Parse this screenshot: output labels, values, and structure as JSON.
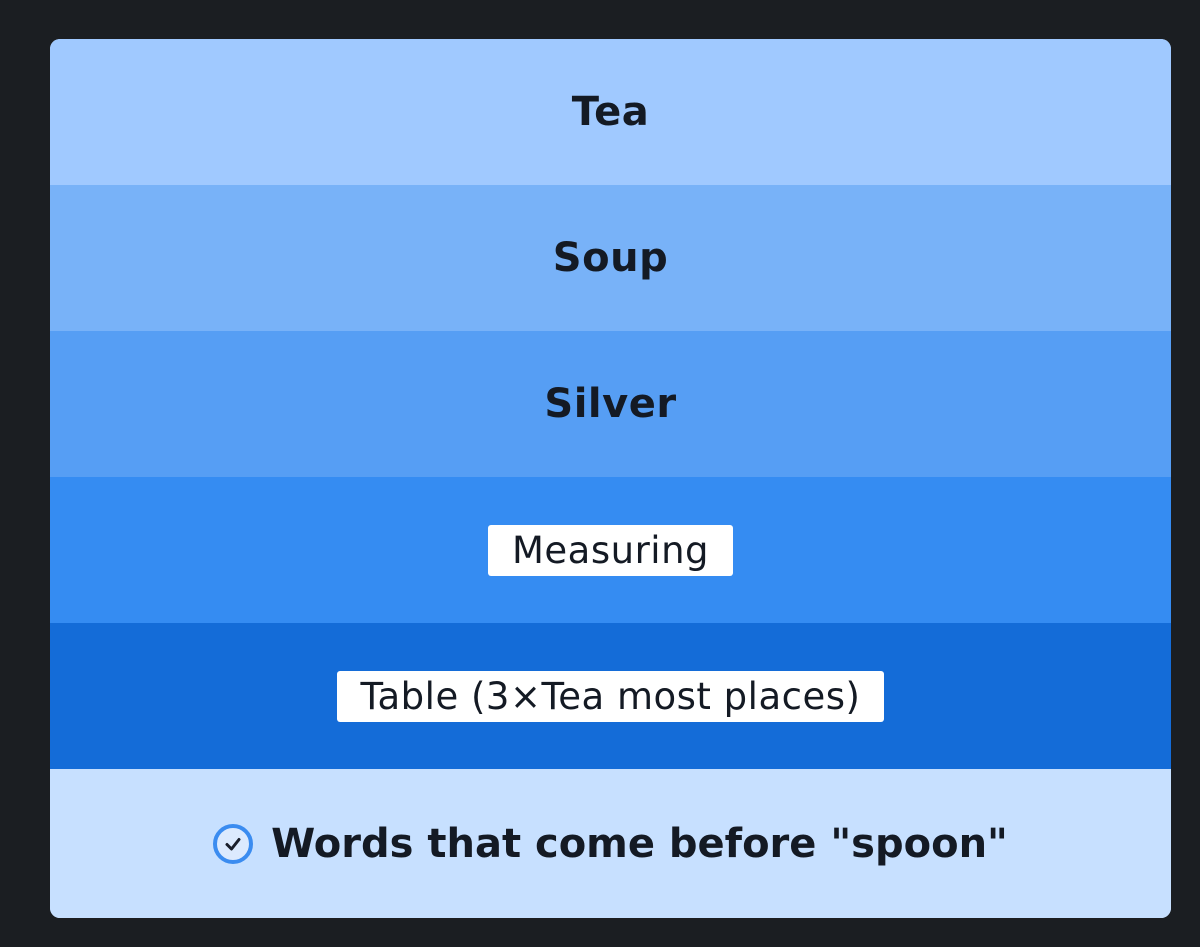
{
  "rows": [
    {
      "label": "Tea",
      "bg": "#a0c9ff",
      "style": "plain"
    },
    {
      "label": "Soup",
      "bg": "#78b2f8",
      "style": "plain"
    },
    {
      "label": "Silver",
      "bg": "#569ef4",
      "style": "plain"
    },
    {
      "label": "Measuring",
      "bg": "#358cf2",
      "style": "pill"
    },
    {
      "label": "Table (3×Tea most places)",
      "bg": "#146cd8",
      "style": "pill"
    }
  ],
  "footer": {
    "text": "Words that come before \"spoon\"",
    "icon": "check-circle-icon",
    "bg": "#c7e0ff"
  }
}
